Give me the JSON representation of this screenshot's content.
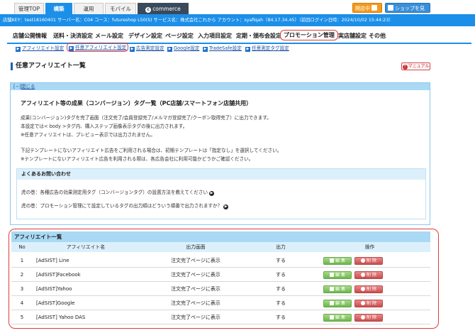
{
  "top_tabs": [
    "管理TOP",
    "構築",
    "運用",
    "モバイル"
  ],
  "cc_tab": "commerce creator",
  "shop_btn_front": "開店中",
  "shop_btn_view": "ショップを見る",
  "info_bar": "店舗KEY：test18160401  サーバー名：C04  コース：futureshop L50(S)  サービス名：株式会社これから  アカウント：syafiqah（84.17.34.45）（前回ログイン日時：2024/10/02 15:44:23）",
  "main_nav": [
    "店舗公開情報",
    "送料・決済設定",
    "メール設定",
    "デザイン設定",
    "ページ設定",
    "入力項目設定",
    "定期・頒布会設定",
    "プロモーション管理",
    "実店舗設定",
    "その他"
  ],
  "sub_nav": [
    "アフィリエイト設定",
    "任意アフィリエイト設定",
    "広告測定設定",
    "Google設定",
    "TradeSafe設定",
    "任意測定タグ設定"
  ],
  "page_title": "任意アフィリエイト一覧",
  "manual_btn": "マニュアル",
  "close_prefix": "[−]",
  "close_link": "閉じる",
  "info_title": "アフィリエイト等の成果（コンバージョン）タグ一覧（PC店舗/スマートフォン店舗共用）",
  "info_lines": [
    "成果(コンバージョン)タグを完了画面（注文完了/会員登録完了/メルマガ登録完了/クーポン取得完了）に出力できます。",
    "本設定では< body >タグ内、購入ステップ画像表示タグの後に出力されます。",
    "※任意アフィリエイトは、プレビュー表示では出力されません。",
    "下記テンプレートにないアフィリエイト広告をご利用される場合は、初期テンプレートは「指定なし」を選択してください。",
    "※テンプレートにないアフィリエイト広告を利用される際は、各広告会社に利用可能かどうかご確認ください。"
  ],
  "faq_title": "よくあるお問い合わせ",
  "faq_items": [
    "虎の巻：各種広告の効果測定用タグ（コンバージョンタグ）の設置方法を教えてください",
    "虎の巻：プロモーション管理にて設定しているタグの出力順はどういう順番で出力されますか？"
  ],
  "list_title": "アフィリエイト一覧",
  "columns": [
    "No",
    "アフィリエイト名",
    "出力画面",
    "出力",
    "操作"
  ],
  "rows": [
    {
      "no": "1",
      "name": "[AdSIST] Line",
      "screen": "注文完了ページに表示",
      "output": "する"
    },
    {
      "no": "2",
      "name": "[AdSIST]Facebook",
      "screen": "注文完了ページに表示",
      "output": "する"
    },
    {
      "no": "3",
      "name": "[AdSIST]Yahoo",
      "screen": "注文完了ページに表示",
      "output": "する"
    },
    {
      "no": "4",
      "name": "[AdSIST]Google",
      "screen": "注文完了ページに表示",
      "output": "する"
    },
    {
      "no": "5",
      "name": "[AdSIST] Yahoo DAS",
      "screen": "注文完了ページに表示",
      "output": "する"
    }
  ],
  "edit_label": "編 集",
  "delete_label": "削 除"
}
